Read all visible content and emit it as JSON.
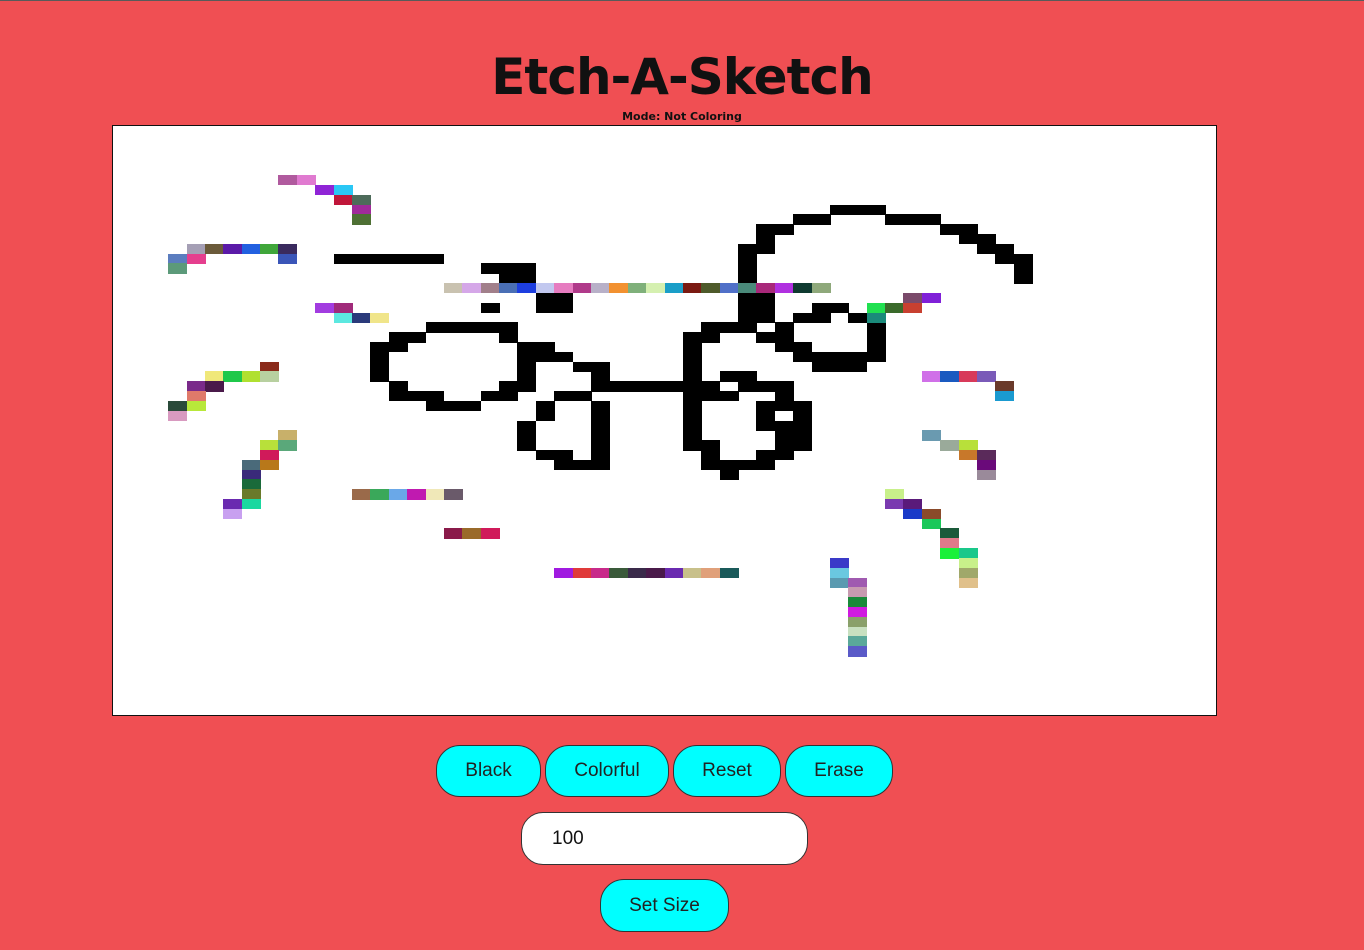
{
  "app": {
    "title": "Etch-A-Sketch",
    "mode_text": "Mode: Not Coloring"
  },
  "controls": {
    "black_label": "Black",
    "colorful_label": "Colorful",
    "reset_label": "Reset",
    "erase_label": "Erase",
    "size_value": "100",
    "set_size_label": "Set Size"
  },
  "colors": {
    "background": "#f04f53",
    "button": "#00ffff",
    "board": "#ffffff",
    "ink": "#000000"
  },
  "grid": {
    "columns": 60,
    "rows": 60,
    "black_runs": [
      [
        13,
        12,
        17
      ],
      [
        14,
        20,
        22
      ],
      [
        15,
        21,
        22
      ],
      [
        16,
        19,
        20
      ],
      [
        16,
        23,
        24
      ],
      [
        17,
        23,
        24
      ],
      [
        18,
        20,
        20
      ],
      [
        18,
        23,
        24
      ],
      [
        20,
        17,
        21
      ],
      [
        21,
        15,
        16
      ],
      [
        21,
        21,
        21
      ],
      [
        22,
        14,
        15
      ],
      [
        22,
        22,
        23
      ],
      [
        23,
        14,
        14
      ],
      [
        23,
        22,
        24
      ],
      [
        24,
        14,
        14
      ],
      [
        24,
        22,
        22
      ],
      [
        24,
        25,
        26
      ],
      [
        25,
        14,
        14
      ],
      [
        25,
        22,
        22
      ],
      [
        25,
        26,
        26
      ],
      [
        26,
        15,
        15
      ],
      [
        26,
        21,
        22
      ],
      [
        26,
        26,
        32
      ],
      [
        27,
        15,
        17
      ],
      [
        27,
        20,
        21
      ],
      [
        27,
        24,
        25
      ],
      [
        27,
        32,
        33
      ],
      [
        28,
        17,
        19
      ],
      [
        28,
        23,
        23
      ],
      [
        28,
        26,
        26
      ],
      [
        28,
        35,
        35
      ],
      [
        29,
        23,
        23
      ],
      [
        29,
        26,
        26
      ],
      [
        29,
        35,
        35
      ],
      [
        30,
        22,
        22
      ],
      [
        30,
        26,
        26
      ],
      [
        30,
        35,
        36
      ],
      [
        31,
        22,
        22
      ],
      [
        31,
        26,
        26
      ],
      [
        31,
        36,
        36
      ],
      [
        32,
        22,
        22
      ],
      [
        32,
        26,
        26
      ],
      [
        32,
        36,
        36
      ],
      [
        33,
        23,
        24
      ],
      [
        33,
        26,
        26
      ],
      [
        33,
        35,
        36
      ],
      [
        34,
        24,
        26
      ],
      [
        34,
        33,
        35
      ],
      [
        8,
        39,
        41
      ],
      [
        9,
        37,
        38
      ],
      [
        9,
        42,
        44
      ],
      [
        10,
        35,
        36
      ],
      [
        10,
        45,
        46
      ],
      [
        11,
        35,
        35
      ],
      [
        11,
        46,
        47
      ],
      [
        12,
        34,
        35
      ],
      [
        12,
        47,
        48
      ],
      [
        13,
        34,
        34
      ],
      [
        13,
        48,
        49
      ],
      [
        14,
        34,
        34
      ],
      [
        14,
        49,
        49
      ],
      [
        15,
        34,
        34
      ],
      [
        15,
        49,
        49
      ],
      [
        16,
        34,
        34
      ],
      [
        17,
        34,
        35
      ],
      [
        18,
        34,
        35
      ],
      [
        18,
        38,
        39
      ],
      [
        19,
        34,
        35
      ],
      [
        19,
        37,
        38
      ],
      [
        19,
        40,
        41
      ],
      [
        20,
        32,
        34
      ],
      [
        20,
        36,
        36
      ],
      [
        20,
        41,
        41
      ],
      [
        21,
        31,
        32
      ],
      [
        21,
        35,
        36
      ],
      [
        21,
        41,
        41
      ],
      [
        22,
        31,
        31
      ],
      [
        22,
        36,
        37
      ],
      [
        22,
        41,
        41
      ],
      [
        23,
        31,
        31
      ],
      [
        23,
        37,
        41
      ],
      [
        24,
        31,
        31
      ],
      [
        24,
        38,
        40
      ],
      [
        25,
        31,
        31
      ],
      [
        25,
        33,
        34
      ],
      [
        26,
        31,
        31
      ],
      [
        26,
        34,
        36
      ],
      [
        27,
        31,
        31
      ],
      [
        27,
        36,
        36
      ],
      [
        28,
        31,
        31
      ],
      [
        28,
        36,
        37
      ],
      [
        29,
        31,
        31
      ],
      [
        29,
        37,
        37
      ],
      [
        30,
        31,
        31
      ],
      [
        30,
        37,
        37
      ],
      [
        31,
        31,
        31
      ],
      [
        31,
        37,
        37
      ],
      [
        32,
        31,
        32
      ],
      [
        32,
        36,
        37
      ],
      [
        33,
        32,
        32
      ],
      [
        33,
        35,
        36
      ],
      [
        34,
        32,
        33
      ],
      [
        34,
        34,
        35
      ],
      [
        35,
        33,
        33
      ]
    ],
    "color_cells": [
      [
        5,
        9,
        "#b05a9e"
      ],
      [
        5,
        10,
        "#e07ad0"
      ],
      [
        6,
        11,
        "#8f24d6"
      ],
      [
        6,
        12,
        "#2ac7f5"
      ],
      [
        7,
        12,
        "#c0163a"
      ],
      [
        7,
        13,
        "#4d6b5a"
      ],
      [
        8,
        13,
        "#a02a9a"
      ],
      [
        9,
        13,
        "#4e7034"
      ],
      [
        12,
        4,
        "#a59fb5"
      ],
      [
        12,
        5,
        "#6b5a3a"
      ],
      [
        12,
        6,
        "#5b1aa8"
      ],
      [
        12,
        7,
        "#2260e0"
      ],
      [
        12,
        8,
        "#3fa63a"
      ],
      [
        12,
        9,
        "#3a2a5e"
      ],
      [
        13,
        3,
        "#5b7dbf"
      ],
      [
        13,
        4,
        "#e53e8e"
      ],
      [
        13,
        9,
        "#3a55b8"
      ],
      [
        14,
        3,
        "#5c9a7a"
      ],
      [
        16,
        18,
        "#c9c2b0"
      ],
      [
        16,
        19,
        "#d5a7e8"
      ],
      [
        16,
        20,
        "#a17f8a"
      ],
      [
        16,
        21,
        "#4a6fb5"
      ],
      [
        16,
        22,
        "#1d3ee0"
      ],
      [
        16,
        23,
        "#c2c8ef"
      ],
      [
        16,
        24,
        "#e67cc0"
      ],
      [
        16,
        25,
        "#b03a8a"
      ],
      [
        16,
        26,
        "#b8b0c8"
      ],
      [
        16,
        27,
        "#f29130"
      ],
      [
        16,
        28,
        "#7fb07a"
      ],
      [
        16,
        29,
        "#d5f0b0"
      ],
      [
        16,
        30,
        "#1a9ec8"
      ],
      [
        16,
        31,
        "#7a1a12"
      ],
      [
        16,
        32,
        "#4e5a2a"
      ],
      [
        16,
        33,
        "#5070c8"
      ],
      [
        16,
        34,
        "#4a8a7a"
      ],
      [
        16,
        35,
        "#a8287a"
      ],
      [
        16,
        36,
        "#b030e0"
      ],
      [
        16,
        37,
        "#0f3a30"
      ],
      [
        16,
        38,
        "#8ea87a"
      ],
      [
        17,
        43,
        "#7a4a6a"
      ],
      [
        17,
        44,
        "#8020d8"
      ],
      [
        18,
        41,
        "#20e050"
      ],
      [
        18,
        42,
        "#3a6a2a"
      ],
      [
        18,
        43,
        "#c84030"
      ],
      [
        19,
        41,
        "#1a8a7a"
      ],
      [
        18,
        11,
        "#a23ce0"
      ],
      [
        18,
        12,
        "#a02a7a"
      ],
      [
        19,
        12,
        "#5ce8e0"
      ],
      [
        19,
        13,
        "#2a3a7a"
      ],
      [
        19,
        14,
        "#f0e58a"
      ],
      [
        24,
        8,
        "#8a2a1a"
      ],
      [
        25,
        5,
        "#f0e87a"
      ],
      [
        25,
        6,
        "#1fc84a"
      ],
      [
        25,
        7,
        "#b0e030"
      ],
      [
        25,
        8,
        "#b8d0a0"
      ],
      [
        26,
        4,
        "#7a2a8a"
      ],
      [
        26,
        5,
        "#4a1a4a"
      ],
      [
        27,
        4,
        "#e07a6a"
      ],
      [
        28,
        3,
        "#2a4a3a"
      ],
      [
        28,
        4,
        "#b8e83a"
      ],
      [
        29,
        3,
        "#d89ac0"
      ],
      [
        25,
        44,
        "#d070e8"
      ],
      [
        25,
        45,
        "#1a5ac0"
      ],
      [
        25,
        46,
        "#d83a5a"
      ],
      [
        25,
        47,
        "#7a5ab8"
      ],
      [
        26,
        48,
        "#6a3a2a"
      ],
      [
        27,
        48,
        "#1a9ad0"
      ],
      [
        31,
        9,
        "#c8b06a"
      ],
      [
        32,
        8,
        "#b8e03a"
      ],
      [
        32,
        9,
        "#5aa87a"
      ],
      [
        33,
        8,
        "#d01a5a"
      ],
      [
        34,
        7,
        "#4a6a7a"
      ],
      [
        34,
        8,
        "#b8781a"
      ],
      [
        35,
        7,
        "#3a2a7a"
      ],
      [
        36,
        7,
        "#1a6a3a"
      ],
      [
        37,
        7,
        "#6a7a2a"
      ],
      [
        38,
        6,
        "#6a2ab0"
      ],
      [
        38,
        7,
        "#1ad8a0"
      ],
      [
        39,
        6,
        "#c8a0f0"
      ],
      [
        31,
        44,
        "#6a9ab0"
      ],
      [
        32,
        45,
        "#9aaa9a"
      ],
      [
        32,
        46,
        "#b8e03a"
      ],
      [
        33,
        46,
        "#c8782a"
      ],
      [
        33,
        47,
        "#5a2a5a"
      ],
      [
        34,
        47,
        "#6a0a7a"
      ],
      [
        35,
        47,
        "#9a8a9a"
      ],
      [
        37,
        13,
        "#9a6a4a"
      ],
      [
        37,
        14,
        "#3aa85a"
      ],
      [
        37,
        15,
        "#6aa8e8"
      ],
      [
        37,
        16,
        "#c01ab0"
      ],
      [
        37,
        17,
        "#f0e8b8"
      ],
      [
        37,
        18,
        "#6a5a6a"
      ],
      [
        37,
        42,
        "#c8f08a"
      ],
      [
        38,
        42,
        "#7a3ab0"
      ],
      [
        38,
        43,
        "#5a1a7a"
      ],
      [
        39,
        43,
        "#1a3ac8"
      ],
      [
        39,
        44,
        "#8a4a2a"
      ],
      [
        40,
        44,
        "#1ac85a"
      ],
      [
        41,
        45,
        "#1a5a3a"
      ],
      [
        42,
        45,
        "#e07a8a"
      ],
      [
        43,
        45,
        "#1af03a"
      ],
      [
        43,
        46,
        "#1ac88a"
      ],
      [
        44,
        46,
        "#c8f08a"
      ],
      [
        45,
        46,
        "#a0a86a"
      ],
      [
        46,
        46,
        "#e0c08a"
      ],
      [
        41,
        18,
        "#8a1a4a"
      ],
      [
        41,
        19,
        "#9a6a2a"
      ],
      [
        41,
        20,
        "#d01a5a"
      ],
      [
        45,
        24,
        "#a01ae0"
      ],
      [
        45,
        25,
        "#e03a3a"
      ],
      [
        45,
        26,
        "#c82a8a"
      ],
      [
        45,
        27,
        "#3a5a3a"
      ],
      [
        45,
        28,
        "#3a2a4a"
      ],
      [
        45,
        29,
        "#4a1a4a"
      ],
      [
        45,
        30,
        "#6a2ab0"
      ],
      [
        45,
        31,
        "#c8c08a"
      ],
      [
        45,
        32,
        "#e0a07a"
      ],
      [
        45,
        33,
        "#1a5a5a"
      ],
      [
        44,
        39,
        "#3a3ac8"
      ],
      [
        45,
        39,
        "#6ac8e0"
      ],
      [
        46,
        39,
        "#5a9ab0"
      ],
      [
        46,
        40,
        "#a05ab0"
      ],
      [
        47,
        40,
        "#c89ab0"
      ],
      [
        48,
        40,
        "#1a8a3a"
      ],
      [
        49,
        40,
        "#d01ae0"
      ],
      [
        50,
        40,
        "#8aa06a"
      ],
      [
        51,
        40,
        "#c8e0c0"
      ],
      [
        52,
        40,
        "#5aa89a"
      ],
      [
        53,
        40,
        "#5a5ac8"
      ]
    ]
  }
}
